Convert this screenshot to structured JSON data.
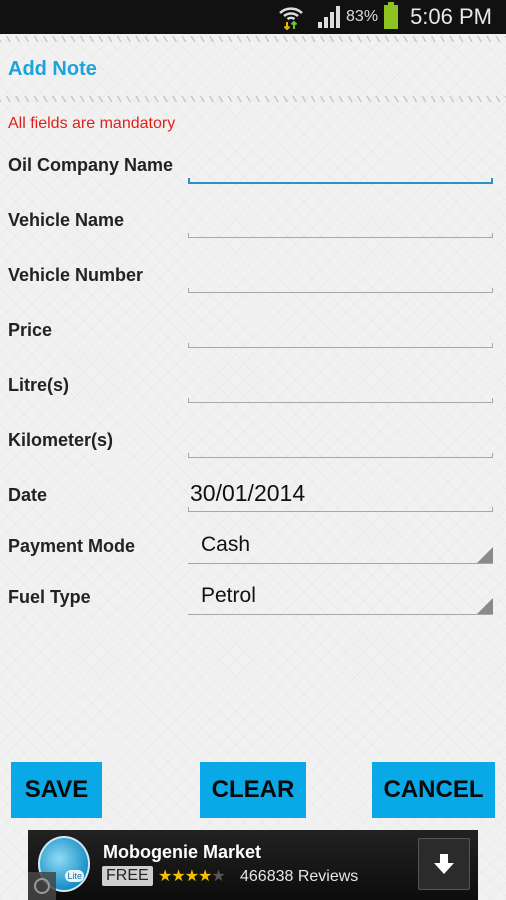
{
  "status_bar": {
    "wifi_icon": "wifi-icon",
    "signal_icon": "signal-icon",
    "battery_percent": "83%",
    "battery_icon": "battery-icon",
    "time": "5:06 PM"
  },
  "header": {
    "title": "Add Note",
    "note": "All fields are mandatory"
  },
  "form": {
    "fields": [
      {
        "label": "Oil Company Name",
        "value": "",
        "focused": true
      },
      {
        "label": "Vehicle Name",
        "value": ""
      },
      {
        "label": "Vehicle Number",
        "value": ""
      },
      {
        "label": "Price",
        "value": ""
      },
      {
        "label": "Litre(s)",
        "value": ""
      },
      {
        "label": "Kilometer(s)",
        "value": ""
      },
      {
        "label": "Date",
        "value": "30/01/2014"
      }
    ],
    "spinners": [
      {
        "label": "Payment Mode",
        "value": "Cash"
      },
      {
        "label": "Fuel Type",
        "value": "Petrol"
      }
    ]
  },
  "buttons": {
    "save": "SAVE",
    "clear": "CLEAR",
    "cancel": "CANCEL"
  },
  "ad": {
    "app_name": "Mobogenie Market",
    "logo_badge": "Lite",
    "price": "FREE",
    "rating": 4,
    "rating_max": 5,
    "stars_on": "★★★★",
    "stars_off": "★",
    "reviews": "466838 Reviews",
    "download_icon": "download-arrow-icon"
  },
  "colors": {
    "accent": "#1aa3dc",
    "button": "#08a9e6",
    "error": "#e0201c",
    "focus_line": "#2a93c4"
  }
}
